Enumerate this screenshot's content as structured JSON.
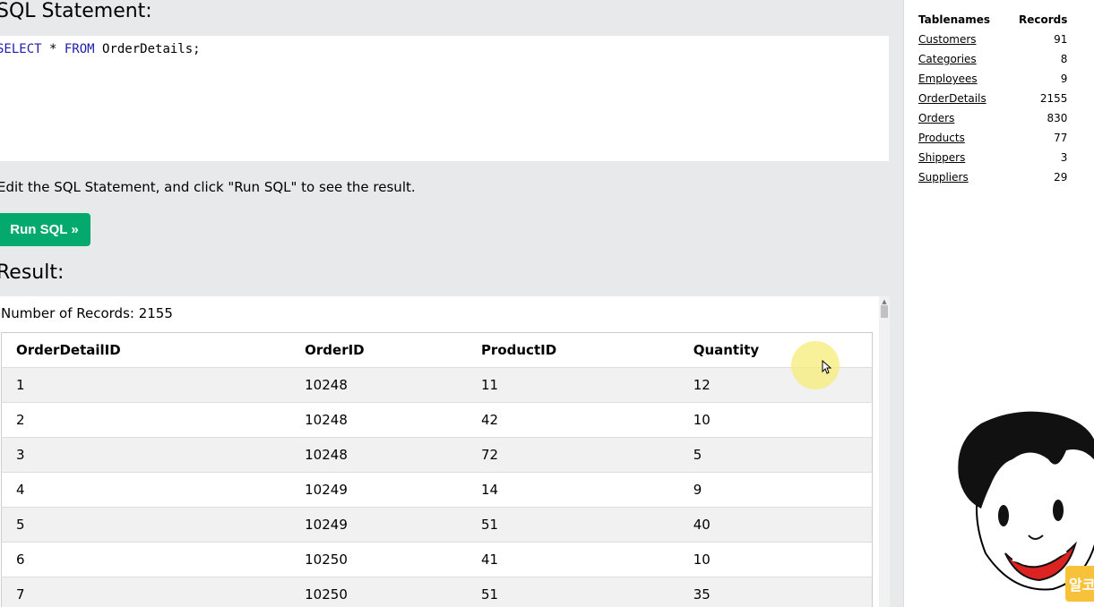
{
  "editor": {
    "heading": "SQL Statement:",
    "kw1": "SELECT",
    "star": " * ",
    "kw2": "FROM",
    "table": " OrderDetails;"
  },
  "instructions": "Edit the SQL Statement, and click \"Run SQL\" to see the result.",
  "run_button": "Run SQL »",
  "result": {
    "heading": "Result:",
    "count_text": "Number of Records: 2155",
    "columns": [
      "OrderDetailID",
      "OrderID",
      "ProductID",
      "Quantity"
    ],
    "rows": [
      [
        "1",
        "10248",
        "11",
        "12"
      ],
      [
        "2",
        "10248",
        "42",
        "10"
      ],
      [
        "3",
        "10248",
        "72",
        "5"
      ],
      [
        "4",
        "10249",
        "14",
        "9"
      ],
      [
        "5",
        "10249",
        "51",
        "40"
      ],
      [
        "6",
        "10250",
        "41",
        "10"
      ],
      [
        "7",
        "10250",
        "51",
        "35"
      ]
    ]
  },
  "sidebar": {
    "header_name": "Tablenames",
    "header_records": "Records",
    "tables": [
      {
        "name": "Customers",
        "records": "91"
      },
      {
        "name": "Categories",
        "records": "8"
      },
      {
        "name": "Employees",
        "records": "9"
      },
      {
        "name": "OrderDetails",
        "records": "2155"
      },
      {
        "name": "Orders",
        "records": "830"
      },
      {
        "name": "Products",
        "records": "77"
      },
      {
        "name": "Shippers",
        "records": "3"
      },
      {
        "name": "Suppliers",
        "records": "29"
      }
    ]
  },
  "overlay": {
    "badge_text": "알코"
  },
  "colors": {
    "accent": "#04aa6d",
    "keyword": "#1d1db0",
    "background": "#e7e9eb"
  },
  "icons": {
    "cursor": "mouse-pointer-icon",
    "avatar": "cartoon-face-icon"
  }
}
